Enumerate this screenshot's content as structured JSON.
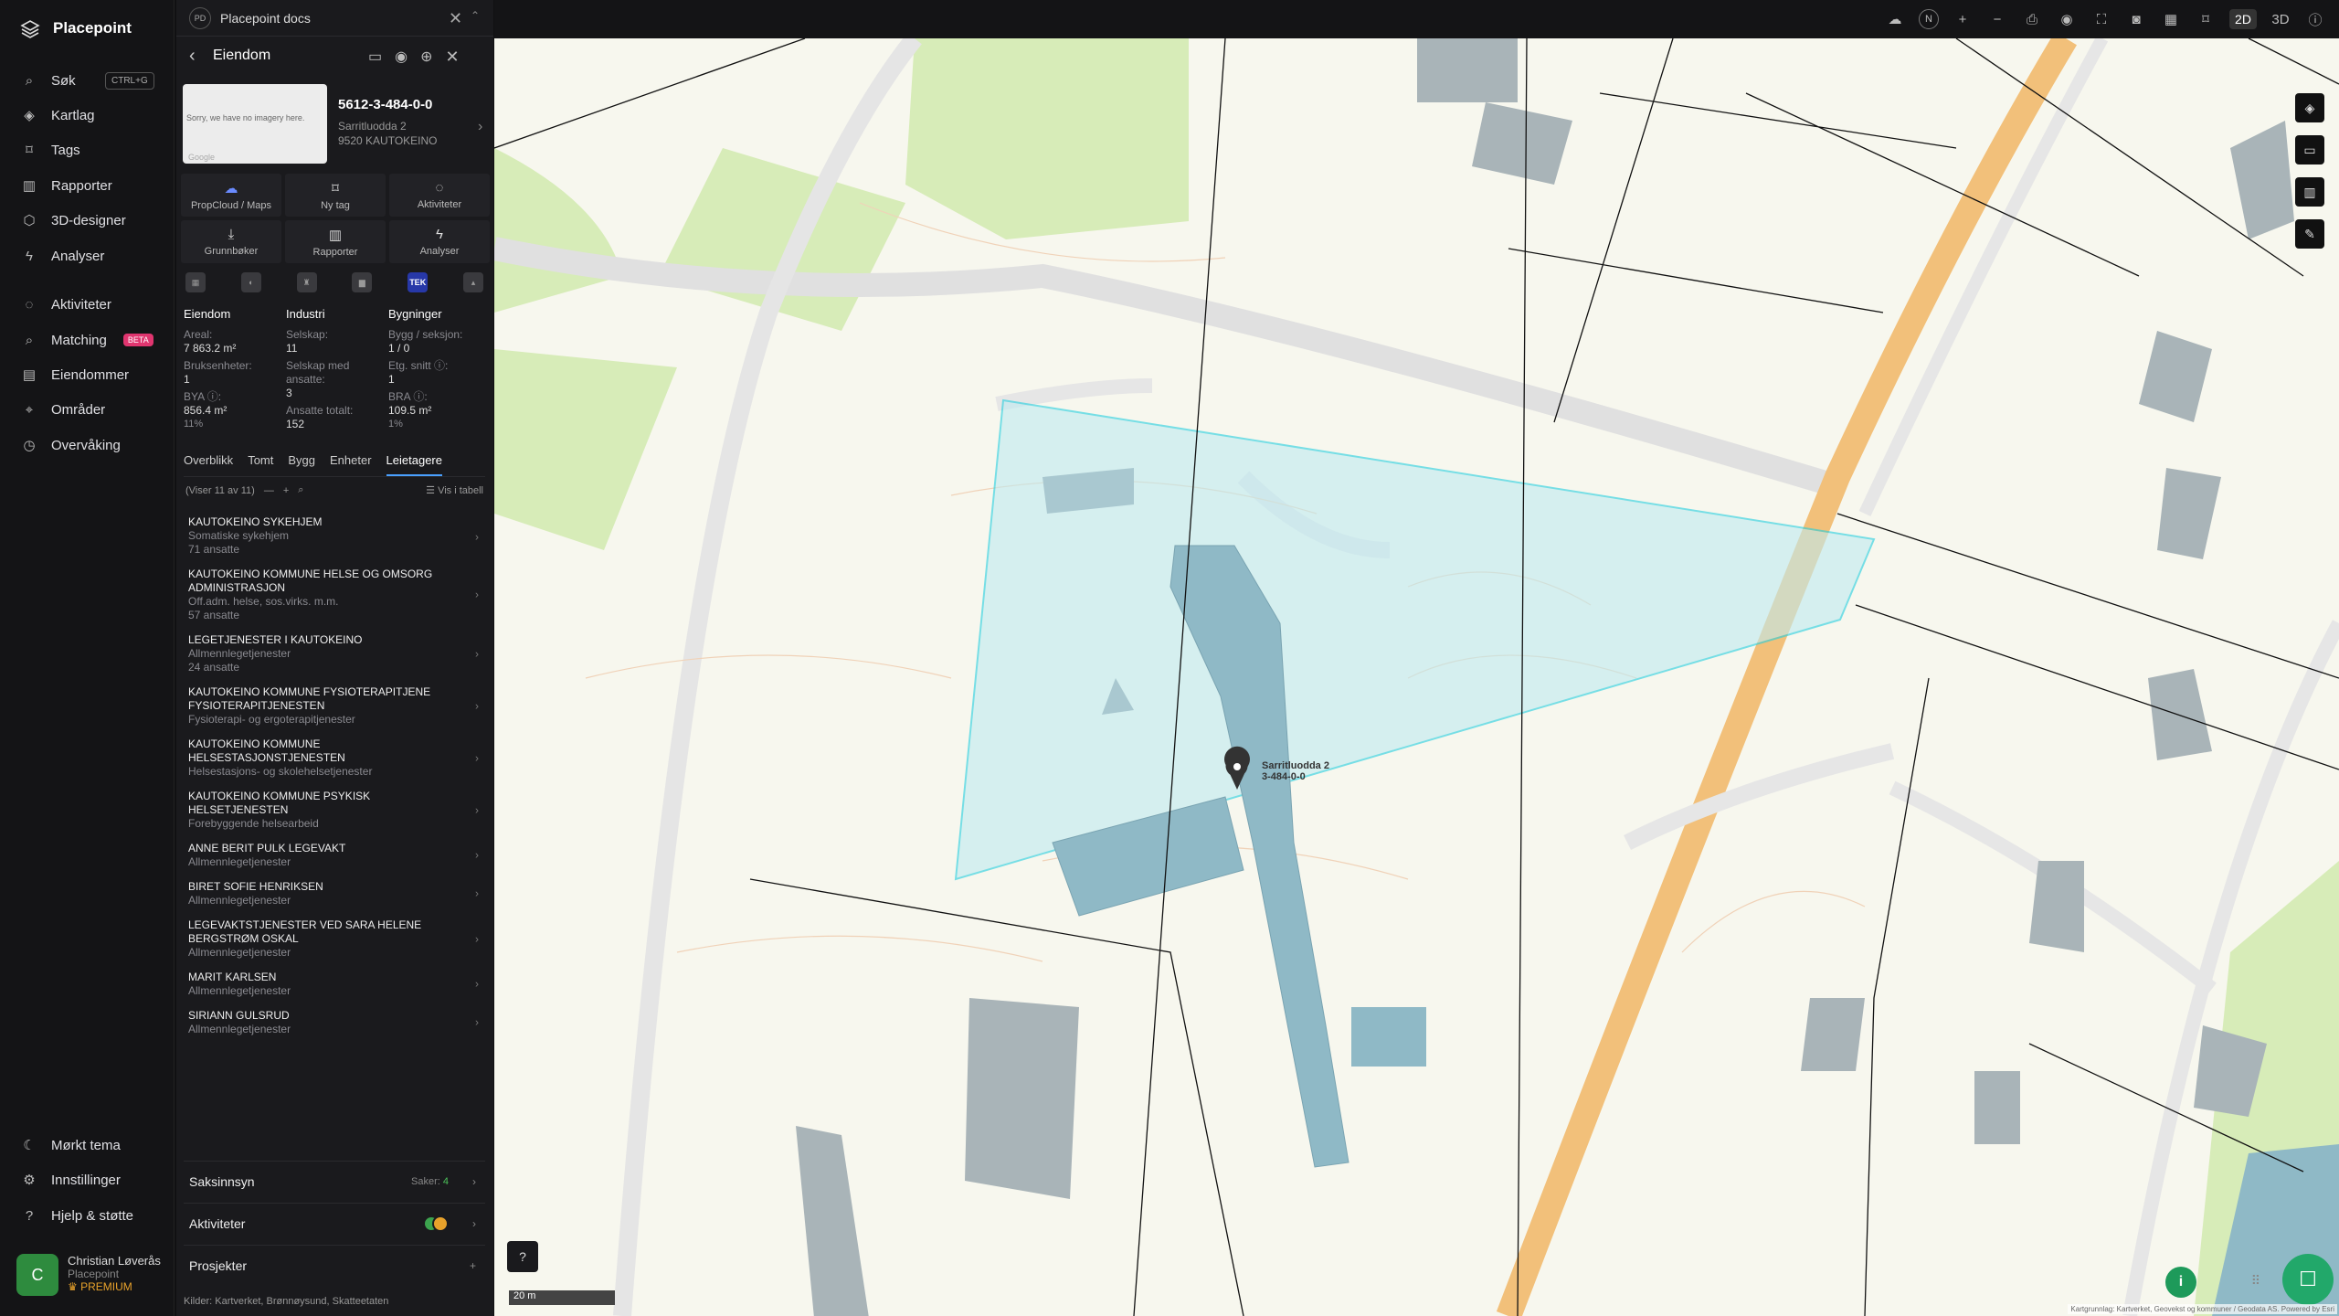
{
  "app": {
    "name": "Placepoint"
  },
  "nav": {
    "items": [
      {
        "label": "Søk",
        "icon": "search-icon",
        "shortcut": "CTRL+G"
      },
      {
        "label": "Kartlag",
        "icon": "layers-icon"
      },
      {
        "label": "Tags",
        "icon": "bookmark-icon"
      },
      {
        "label": "Rapporter",
        "icon": "chart-icon"
      },
      {
        "label": "3D-designer",
        "icon": "cube-icon"
      },
      {
        "label": "Analyser",
        "icon": "bolt-icon"
      },
      {
        "label": "Aktiviteter",
        "icon": "chat-icon"
      },
      {
        "label": "Matching",
        "icon": "match-icon",
        "badge": "BETA"
      },
      {
        "label": "Eiendommer",
        "icon": "list-icon"
      },
      {
        "label": "Områder",
        "icon": "area-icon"
      },
      {
        "label": "Overvåking",
        "icon": "watch-icon"
      }
    ],
    "bottom": [
      {
        "label": "Mørkt tema",
        "icon": "moon-icon"
      },
      {
        "label": "Innstillinger",
        "icon": "gear-icon"
      },
      {
        "label": "Hjelp & støtte",
        "icon": "help-icon"
      }
    ],
    "user": {
      "initial": "C",
      "name": "Christian Løverås",
      "org": "Placepoint",
      "plan": "PREMIUM"
    }
  },
  "docs": {
    "badge": "PD",
    "title": "Placepoint docs"
  },
  "panel": {
    "title": "Eiendom",
    "thumb_text": "Sorry, we have no imagery here.",
    "thumb_credit": "Google",
    "prop_id": "5612-3-484-0-0",
    "address1": "Sarritluodda 2",
    "address2": "9520 KAUTOKEINO",
    "actions": [
      "PropCloud / Maps",
      "Ny tag",
      "Aktiviteter",
      "Grunnbøker",
      "Rapporter",
      "Analyser"
    ],
    "sources_tek": "TEK",
    "cols": {
      "eiendom": {
        "title": "Eiendom",
        "areal_k": "Areal:",
        "areal_v": "7 863.2 m²",
        "bruks_k": "Bruksenheter:",
        "bruks_v": "1",
        "bya_k": "BYA ⓘ:",
        "bya_v": "856.4 m²",
        "bya_p": "11%"
      },
      "industri": {
        "title": "Industri",
        "selskap_k": "Selskap:",
        "selskap_v": "11",
        "ansatte_k": "Selskap med ansatte:",
        "ansatte_v": "3",
        "tot_k": "Ansatte totalt:",
        "tot_v": "152"
      },
      "bygninger": {
        "title": "Bygninger",
        "bygg_k": "Bygg / seksjon:",
        "bygg_v": "1 / 0",
        "etg_k": "Etg. snitt ⓘ:",
        "etg_v": "1",
        "bra_k": "BRA ⓘ:",
        "bra_v": "109.5 m²",
        "bra_p": "1%"
      }
    },
    "tabs": [
      "Overblikk",
      "Tomt",
      "Bygg",
      "Enheter",
      "Leietagere"
    ],
    "list_count": "(Viser 11 av 11)",
    "vis_tabell": "Vis i tabell",
    "tenants": [
      {
        "name": "KAUTOKEINO SYKEHJEM",
        "sub": "Somatiske sykehjem",
        "sub2": "71 ansatte"
      },
      {
        "name": "KAUTOKEINO KOMMUNE HELSE OG OMSORG ADMINISTRASJON",
        "sub": "Off.adm. helse, sos.virks. m.m.",
        "sub2": "57 ansatte"
      },
      {
        "name": "LEGETJENESTER I KAUTOKEINO",
        "sub": "Allmennlegetjenester",
        "sub2": "24 ansatte"
      },
      {
        "name": "KAUTOKEINO KOMMUNE FYSIOTERAPITJENE FYSIOTERAPITJENESTEN",
        "sub": "Fysioterapi- og ergoterapitjenester",
        "sub2": ""
      },
      {
        "name": "KAUTOKEINO KOMMUNE HELSESTASJONSTJENESTEN",
        "sub": "Helsestasjons- og skolehelsetjenester",
        "sub2": ""
      },
      {
        "name": "KAUTOKEINO KOMMUNE PSYKISK HELSETJENESTEN",
        "sub": "Forebyggende helsearbeid",
        "sub2": ""
      },
      {
        "name": "ANNE BERIT PULK LEGEVAKT",
        "sub": "Allmennlegetjenester",
        "sub2": ""
      },
      {
        "name": "BIRET SOFIE HENRIKSEN",
        "sub": "Allmennlegetjenester",
        "sub2": ""
      },
      {
        "name": "LEGEVAKTSTJENESTER VED SARA HELENE BERGSTRØM OSKAL",
        "sub": "Allmennlegetjenester",
        "sub2": ""
      },
      {
        "name": "MARIT KARLSEN",
        "sub": "Allmennlegetjenester",
        "sub2": ""
      },
      {
        "name": "SIRIANN GULSRUD",
        "sub": "Allmennlegetjenester",
        "sub2": ""
      }
    ],
    "saksinnsyn": "Saksinnsyn",
    "saker_label": "Saker:",
    "saker_count": "4",
    "aktiviteter": "Aktiviteter",
    "prosjekter": "Prosjekter",
    "kilder": "Kilder:",
    "kilder_list": "Kartverket, Brønnøysund, Skatteetaten"
  },
  "map": {
    "mode_2d": "2D",
    "mode_3d": "3D",
    "north": "N",
    "scale": "20 m",
    "marker_label1": "Sarritluodda 2",
    "marker_label2": "3-484-0-0",
    "attribution": "Kartgrunnlag: Kartverket, Geovekst og kommuner / Geodata AS. Powered by Esri",
    "colors": {
      "parcel": "#22cfe0",
      "building": "#8fb9c6",
      "road": "#f2c07a",
      "grass": "#d7ecb8"
    }
  }
}
